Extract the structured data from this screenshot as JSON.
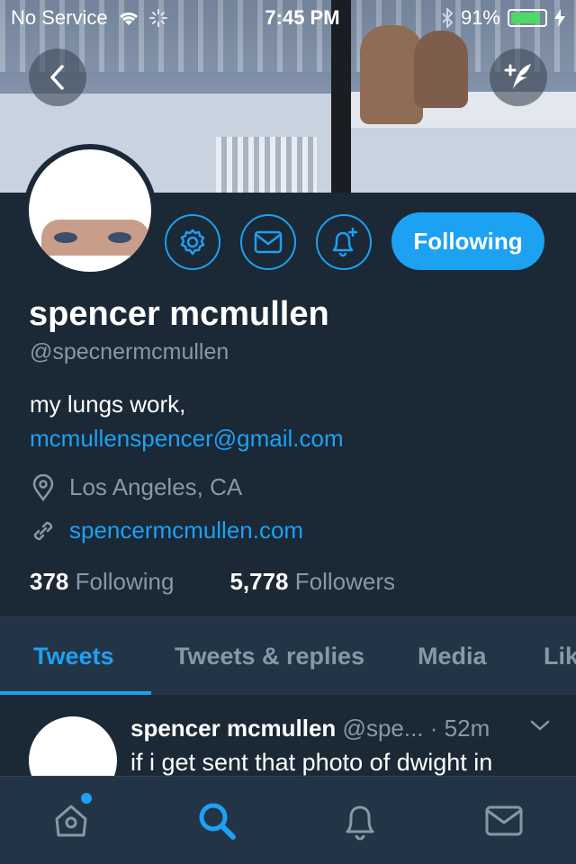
{
  "status_bar": {
    "carrier": "No Service",
    "time": "7:45 PM",
    "battery": "91%",
    "battery_level": 0.91
  },
  "profile": {
    "name": "spencer mcmullen",
    "handle": "@specnermcmullen",
    "bio_text": "my lungs work,",
    "bio_link": "mcmullenspencer@gmail.com",
    "location": "Los Angeles, CA",
    "website": "spencermcmullen.com",
    "following_count": "378",
    "following_label": "Following",
    "followers_count": "5,778",
    "followers_label": "Followers",
    "follow_button": "Following"
  },
  "tabs": [
    "Tweets",
    "Tweets & replies",
    "Media",
    "Lik"
  ],
  "tweet": {
    "name": "spencer mcmullen",
    "handle": "@spe...",
    "time": "· 52m",
    "text": "if i get sent that photo of dwight in"
  },
  "colors": {
    "accent": "#1da1f2",
    "background": "#1b2836",
    "tab_bar": "#243447",
    "muted": "#8899a6"
  },
  "icons": {
    "back": "chevron-left-icon",
    "compose": "compose-feather-icon",
    "settings": "gear-icon",
    "message": "envelope-icon",
    "notify": "bell-plus-icon",
    "location": "location-pin-icon",
    "link": "link-icon",
    "home": "home-icon",
    "search": "search-icon",
    "notifications": "bell-icon",
    "messages": "envelope-icon"
  }
}
